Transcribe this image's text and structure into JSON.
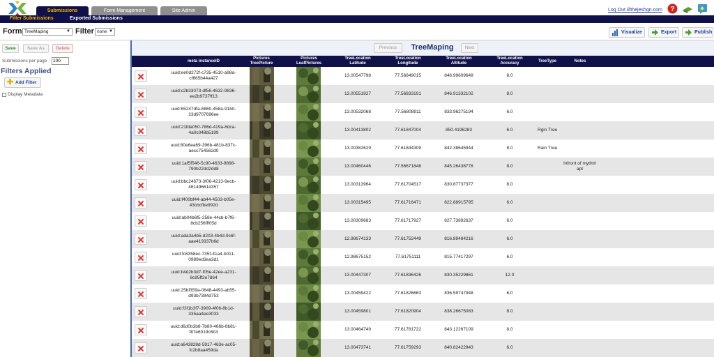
{
  "header": {
    "tabs": [
      {
        "label": "Submissions"
      },
      {
        "label": "Form Management"
      },
      {
        "label": "Site Admin"
      }
    ],
    "logout_text": "Log Out iðthejeshgn.com"
  },
  "subnav": {
    "filter_submissions": "Filter Submissions",
    "exported_submissions": "Exported Submissions"
  },
  "formbar": {
    "form_label": "Form",
    "form_value": "TreeMaping",
    "filter_label": "Filter",
    "filter_value": "none",
    "visualize": "Visualize",
    "export": "Export",
    "publish": "Publish"
  },
  "left": {
    "save": "Save",
    "save_as": "Save As",
    "delete": "Delete",
    "spp_label": "Submissions per page",
    "spp_value": "100",
    "filters_title": "Filters Applied",
    "add_filter": "Add Filter",
    "display_metadata": "Display Metadata"
  },
  "pager": {
    "previous": "Previous",
    "next": "Next",
    "title": "TreeMaping"
  },
  "table": {
    "headers": {
      "instance": "meta instanceID",
      "pic_tree": [
        "Pictures",
        "TreePicture"
      ],
      "pic_leaf": [
        "Pictures",
        "LeafPictures"
      ],
      "lat": [
        "TreeLocation",
        "Latitude"
      ],
      "lon": [
        "TreeLocation",
        "Longitude"
      ],
      "alt": [
        "TreeLocation",
        "Altitude"
      ],
      "acc": [
        "TreeLocation",
        "Accuracy"
      ],
      "type": "TreeType",
      "notes": "Notes"
    },
    "rows": [
      {
        "uuid1": "uuid:ee0d272f-c735-4510-a98a-",
        "uuid2": "cf665b44a427",
        "lat": "13.00547798",
        "lon": "77.56849015",
        "alt": "846.99609649",
        "acc": "8.0",
        "type": "",
        "notes1": "",
        "notes2": ""
      },
      {
        "uuid1": "uuid:c2b33073-df56-4632-9836-",
        "uuid2": "ee2b9737ff13",
        "lat": "13.00551927",
        "lon": "77.56833191",
        "alt": "846.91332102",
        "acc": "8.0",
        "type": "",
        "notes1": "",
        "notes2": ""
      },
      {
        "uuid1": "uuid:65247dfa-6860-458a-91b0-",
        "uuid2": "23d9707696ee",
        "lat": "13.00532068",
        "lon": "77.56808911",
        "alt": "833.96275194",
        "acc": "6.0",
        "type": "",
        "notes1": "",
        "notes2": ""
      },
      {
        "uuid1": "uuid:21fda050-786d-419a-8dca-",
        "uuid2": "4a0c048b5199",
        "lat": "13.00413802",
        "lon": "77.61847004",
        "alt": "850.4196283",
        "acc": "6.0",
        "type": "Rgin Tree",
        "notes1": "",
        "notes2": ""
      },
      {
        "uuid1": "uuid:80e6ea69-396b-481b-837c-",
        "uuid2": "aecc754562d0",
        "lat": "13.00382629",
        "lon": "77.61844309",
        "alt": "842.38645944",
        "acc": "8.0",
        "type": "Rain Tree",
        "notes1": "",
        "notes2": ""
      },
      {
        "uuid1": "uuid:1af5f546-5c90-4633-9898-",
        "uuid2": "790b22dd2dd8",
        "lat": "13.00460446",
        "lon": "77.56671848",
        "alt": "845.26438778",
        "acc": "8.0",
        "type": "",
        "notes1": "Infront of mythtri",
        "notes2": "apt"
      },
      {
        "uuid1": "uuid:bbc24673-3f06-4213-9ecb-",
        "uuid2": "46149661d357",
        "lat": "13.00313964",
        "lon": "77.61704517",
        "alt": "830.87737377",
        "acc": "8.0",
        "type": "",
        "notes1": "",
        "notes2": ""
      },
      {
        "uuid1": "uuid:f400bf44-ab44-4503-b05e-",
        "uuid2": "43cbcfbe992d",
        "lat": "13.00315495",
        "lon": "77.61716471",
        "alt": "822.88915795",
        "acc": "6.0",
        "type": "",
        "notes1": "",
        "notes2": ""
      },
      {
        "uuid1": "uuid:ab04b6f5-258e-44cb-b7f6-",
        "uuid2": "8cb256fff05d",
        "lat": "13.00309683",
        "lon": "77.61717927",
        "alt": "827.73892637",
        "acc": "6.0",
        "type": "",
        "notes1": "",
        "notes2": ""
      },
      {
        "uuid1": "uuid:ada3a4b5-d203-4b4d-9c6f-",
        "uuid2": "aae419337b6d",
        "lat": "12.98674133",
        "lon": "77.61752449",
        "alt": "816.89484216",
        "acc": "6.0",
        "type": "",
        "notes1": "",
        "notes2": ""
      },
      {
        "uuid1": "uuid:fc8358ec-735f-41a4-b011-",
        "uuid2": "0989ed3ea3d1",
        "lat": "12.98675152",
        "lon": "77.61751111",
        "alt": "815.77417297",
        "acc": "6.0",
        "type": "",
        "notes1": "",
        "notes2": ""
      },
      {
        "uuid1": "uuid:b4d2b3d7-f05e-42ee-a231-",
        "uuid2": "8c95ff2e7864",
        "lat": "13.00447307",
        "lon": "77.61836426",
        "alt": "830.35229861",
        "acc": "12.0",
        "type": "",
        "notes1": "",
        "notes2": ""
      },
      {
        "uuid1": "uuid:25bf359a-0648-4493-ab55-",
        "uuid2": "d93b7384d753",
        "lat": "13.00459422",
        "lon": "77.61826663",
        "alt": "836.59747948",
        "acc": "6.0",
        "type": "",
        "notes1": "",
        "notes2": ""
      },
      {
        "uuid1": "uuid:f3f1b3f7-3909-4f06-8b1d-",
        "uuid2": "335aa4ee3033",
        "lat": "13.00459801",
        "lon": "77.61820904",
        "alt": "838.26675083",
        "acc": "8.0",
        "type": "",
        "notes1": "",
        "notes2": ""
      },
      {
        "uuid1": "uuid:d6d0b3b8-7b80-466b-8b81-",
        "uuid2": "f87e6019c6b3",
        "lat": "13.00464749",
        "lon": "77.61781722",
        "alt": "843.12267109",
        "acc": "8.0",
        "type": "",
        "notes1": "",
        "notes2": ""
      },
      {
        "uuid1": "uuid:a643828d-5917-463e-ac05-",
        "uuid2": "fc2b8aa459da",
        "lat": "13.00473741",
        "lon": "77.61759293",
        "alt": "840.82422943",
        "acc": "6.0",
        "type": "",
        "notes1": "",
        "notes2": ""
      }
    ]
  },
  "icons": {
    "logo": "odk-logo-icon",
    "help": "help-icon",
    "book": "book-icon",
    "feedback": "feedback-icon",
    "visualize": "bar-chart-icon",
    "export": "arrow-right-icon",
    "publish": "arrow-right-icon",
    "delete_row": "delete-x-icon",
    "add_filter": "plus-icon"
  },
  "colors": {
    "nav_dark": "#11114a",
    "accent_gold": "#f0b400",
    "link_blue": "#1a3ea0"
  }
}
